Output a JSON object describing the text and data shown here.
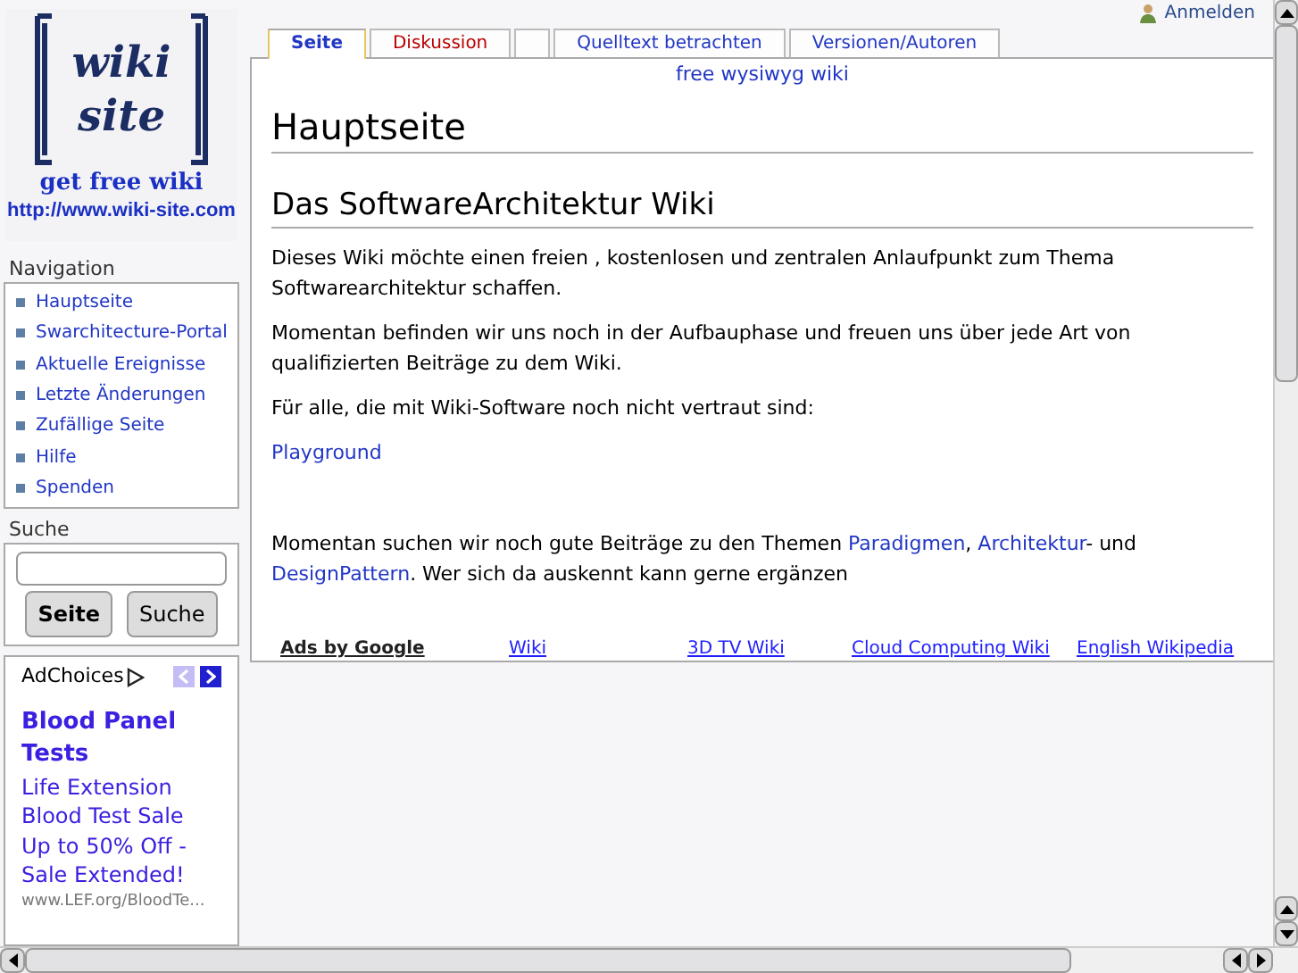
{
  "logo": {
    "title": "wiki site",
    "tagline": "get free wiki",
    "url": "http://www.wiki-site.com"
  },
  "user_link": "Anmelden",
  "tabs": [
    {
      "label": "Seite",
      "selected": true,
      "exists": true,
      "kind": "tab"
    },
    {
      "label": "Diskussion",
      "selected": false,
      "exists": false,
      "kind": "tab"
    },
    {
      "kind": "blank",
      "selected": false
    },
    {
      "label": "Quelltext betrachten",
      "selected": false,
      "exists": true,
      "kind": "tab"
    },
    {
      "label": "Versionen/Autoren",
      "selected": false,
      "exists": true,
      "kind": "tab"
    }
  ],
  "navigation": {
    "heading": "Navigation",
    "items": [
      "Hauptseite",
      "Swarchitecture-Portal",
      "Aktuelle Ereignisse",
      "Letzte Änderungen",
      "Zufällige Seite",
      "Hilfe",
      "Spenden"
    ]
  },
  "search": {
    "heading": "Suche",
    "buttons": [
      "Seite",
      "Suche"
    ]
  },
  "ad": {
    "adchoices": "AdChoices",
    "prev_enabled": false,
    "next_enabled": true,
    "title": "Blood Panel Tests",
    "lines": [
      "Life Extension",
      "Blood Test Sale",
      "Up to 50% Off -",
      "Sale Extended!"
    ],
    "url": "www.LEF.org/BloodTe..."
  },
  "content": {
    "site_sub": "free wysiwyg wiki",
    "title": "Hauptseite",
    "heading": "Das SoftwareArchitektur Wiki",
    "blocks": [
      {
        "kind": "text",
        "parts": [
          {
            "kind": "text",
            "text": "Dieses Wiki möchte einen freien , kostenlosen und zentralen Anlaufpunkt zum Thema Softwarearchitektur schaffen."
          }
        ]
      },
      {
        "kind": "text",
        "parts": [
          {
            "kind": "text",
            "text": "Momentan befinden wir uns noch in der Aufbauphase und freuen uns über jede Art von qualifizierten Beiträge zu dem Wiki."
          }
        ]
      },
      {
        "kind": "text",
        "parts": [
          {
            "kind": "text",
            "text": "Für alle, die mit Wiki-Software noch nicht vertraut sind:"
          }
        ]
      },
      {
        "kind": "link",
        "parts": [
          {
            "kind": "link",
            "text": "Playground"
          }
        ]
      },
      {
        "kind": "spaced",
        "parts": [
          {
            "kind": "text",
            "text": "Momentan suchen wir noch gute Beiträge zu den Themen "
          },
          {
            "kind": "link",
            "text": "Paradigmen"
          },
          {
            "kind": "text",
            "text": ", "
          },
          {
            "kind": "link",
            "text": "Architektur"
          },
          {
            "kind": "text",
            "text": "- und "
          },
          {
            "kind": "link",
            "text": "DesignPattern"
          },
          {
            "kind": "text",
            "text": ". Wer sich da auskennt kann gerne ergänzen"
          }
        ]
      }
    ],
    "ads_label": "Ads by Google",
    "ad_links": [
      "Wiki",
      "3D TV Wiki",
      "Cloud Computing Wiki",
      "English Wikipedia"
    ]
  }
}
